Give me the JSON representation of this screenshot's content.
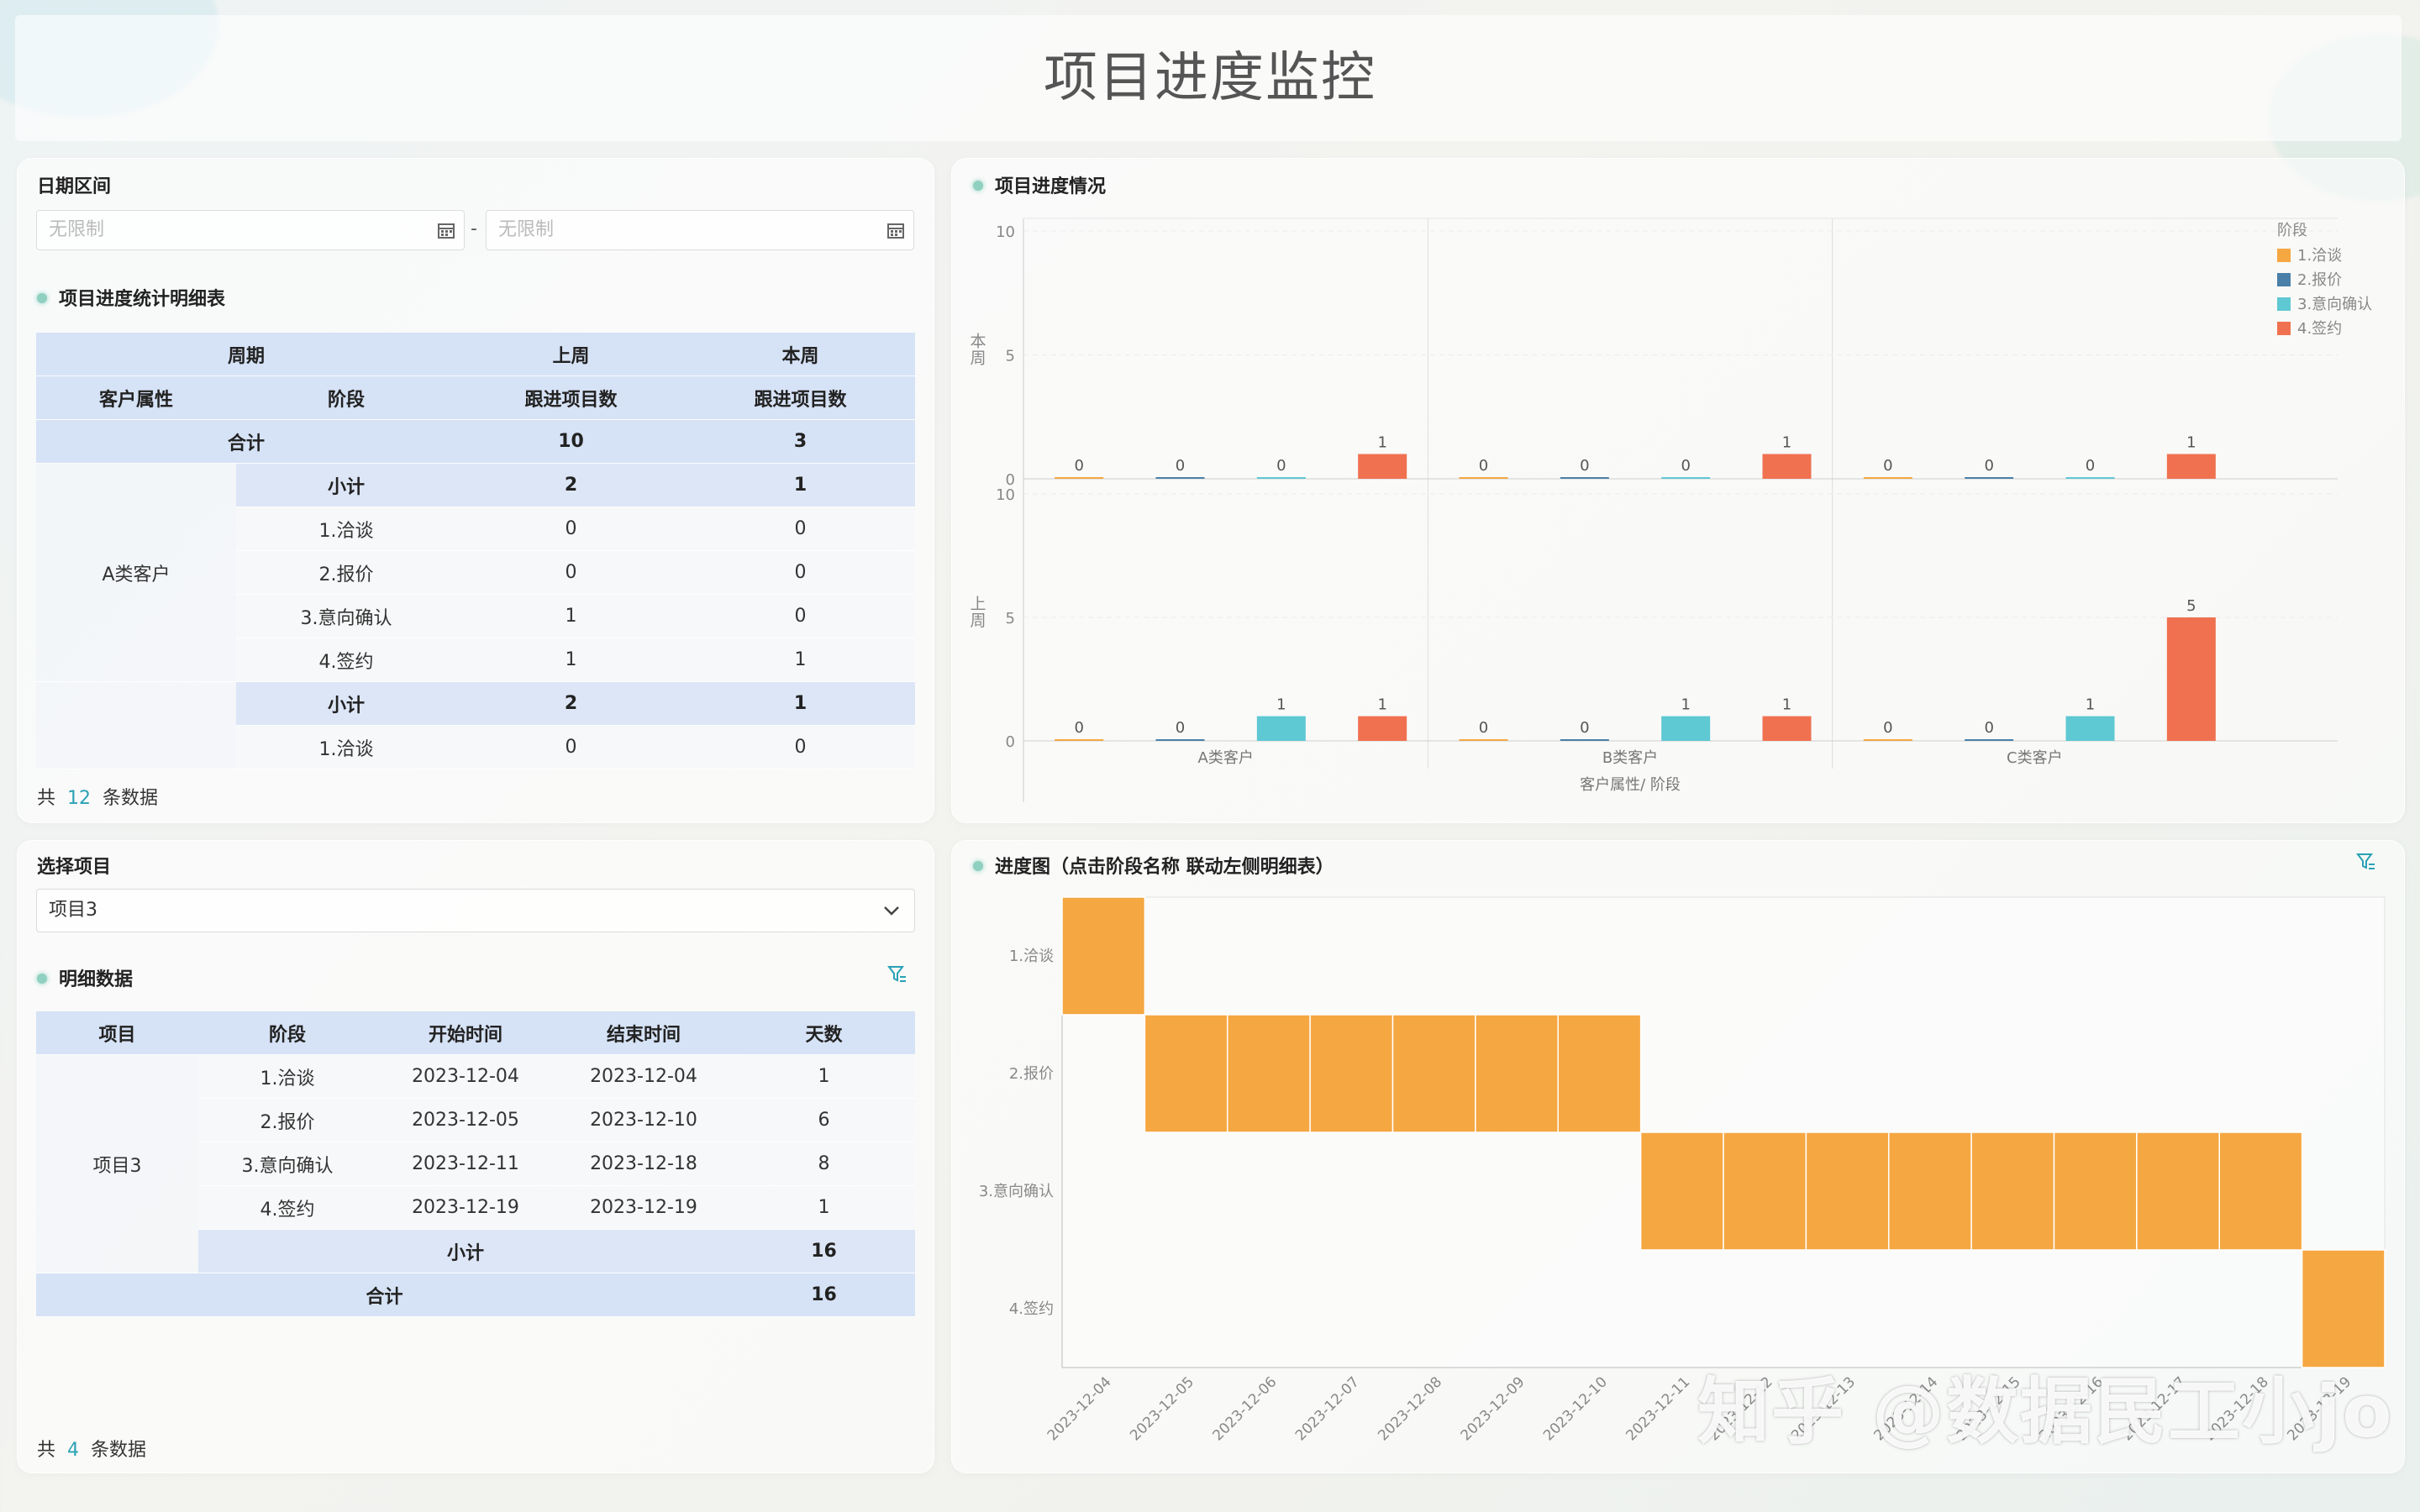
{
  "page": {
    "title": "项目进度监控"
  },
  "date_filter": {
    "label": "日期区间",
    "start_placeholder": "无限制",
    "end_placeholder": "无限制",
    "separator": "-"
  },
  "stats_table": {
    "title": "项目进度统计明细表",
    "header1": [
      "周期",
      "上周",
      "本周"
    ],
    "header2": [
      "客户属性",
      "阶段",
      "跟进项目数",
      "跟进项目数"
    ],
    "total": {
      "label": "合计",
      "last": "10",
      "this": "3"
    },
    "group_a": {
      "name": "A类客户",
      "subtotal": {
        "label": "小计",
        "last": "2",
        "this": "1"
      },
      "rows": [
        {
          "stage": "1.洽谈",
          "last": "0",
          "this": "0"
        },
        {
          "stage": "2.报价",
          "last": "0",
          "this": "0"
        },
        {
          "stage": "3.意向确认",
          "last": "1",
          "this": "0"
        },
        {
          "stage": "4.签约",
          "last": "1",
          "this": "1"
        }
      ]
    },
    "group_b": {
      "subtotal": {
        "label": "小计",
        "last": "2",
        "this": "1"
      },
      "rows": [
        {
          "stage": "1.洽谈",
          "last": "0",
          "this": "0"
        }
      ]
    },
    "footer": {
      "prefix": "共",
      "count": "12",
      "suffix": "条数据"
    }
  },
  "project_select": {
    "label": "选择项目",
    "value": "项目3"
  },
  "detail_table": {
    "title": "明细数据",
    "headers": [
      "项目",
      "阶段",
      "开始时间",
      "结束时间",
      "天数"
    ],
    "project": "项目3",
    "rows": [
      {
        "stage": "1.洽谈",
        "start": "2023-12-04",
        "end": "2023-12-04",
        "days": "1"
      },
      {
        "stage": "2.报价",
        "start": "2023-12-05",
        "end": "2023-12-10",
        "days": "6"
      },
      {
        "stage": "3.意向确认",
        "start": "2023-12-11",
        "end": "2023-12-18",
        "days": "8"
      },
      {
        "stage": "4.签约",
        "start": "2023-12-19",
        "end": "2023-12-19",
        "days": "1"
      }
    ],
    "subtotal": {
      "label": "小计",
      "days": "16"
    },
    "total": {
      "label": "合计",
      "days": "16"
    },
    "footer": {
      "prefix": "共",
      "count": "4",
      "suffix": "条数据"
    }
  },
  "progress_chart_title": "项目进度情况",
  "gantt_title": "进度图（点击阶段名称 联动左侧明细表）",
  "watermark": "知乎 @数据民工小jo",
  "colors": {
    "s1": "#f5a742",
    "s2": "#4a80a8",
    "s3": "#5ec8d3",
    "s4": "#f07150",
    "filter": "#2aa1b5"
  },
  "chart_data": [
    {
      "type": "bar",
      "title": "项目进度情况",
      "xlabel": "客户属性/ 阶段",
      "row_labels": [
        "本周",
        "上周"
      ],
      "categories": [
        "A类客户",
        "B类客户",
        "C类客户"
      ],
      "legend_title": "阶段",
      "legend_position": "top-right",
      "series_names": [
        "1.洽谈",
        "2.报价",
        "3.意向确认",
        "4.签约"
      ],
      "ylim": [
        0,
        10
      ],
      "yticks": [
        0,
        5,
        10
      ],
      "panels": {
        "本周": {
          "A类客户": [
            0,
            0,
            0,
            1
          ],
          "B类客户": [
            0,
            0,
            0,
            1
          ],
          "C类客户": [
            0,
            0,
            0,
            1
          ]
        },
        "上周": {
          "A类客户": [
            0,
            0,
            1,
            1
          ],
          "B类客户": [
            0,
            0,
            1,
            1
          ],
          "C类客户": [
            0,
            0,
            1,
            5
          ]
        }
      }
    },
    {
      "type": "heatmap",
      "title": "进度图（点击阶段名称 联动左侧明细表）",
      "y": [
        "1.洽谈",
        "2.报价",
        "3.意向确认",
        "4.签约"
      ],
      "x": [
        "2023-12-04",
        "2023-12-05",
        "2023-12-06",
        "2023-12-07",
        "2023-12-08",
        "2023-12-09",
        "2023-12-10",
        "2023-12-11",
        "2023-12-12",
        "2023-12-13",
        "2023-12-14",
        "2023-12-15",
        "2023-12-16",
        "2023-12-17",
        "2023-12-18",
        "2023-12-19"
      ],
      "cells": [
        {
          "stage": "1.洽谈",
          "from": "2023-12-04",
          "to": "2023-12-04"
        },
        {
          "stage": "2.报价",
          "from": "2023-12-05",
          "to": "2023-12-10"
        },
        {
          "stage": "3.意向确认",
          "from": "2023-12-11",
          "to": "2023-12-18"
        },
        {
          "stage": "4.签约",
          "from": "2023-12-19",
          "to": "2023-12-19"
        }
      ]
    }
  ]
}
